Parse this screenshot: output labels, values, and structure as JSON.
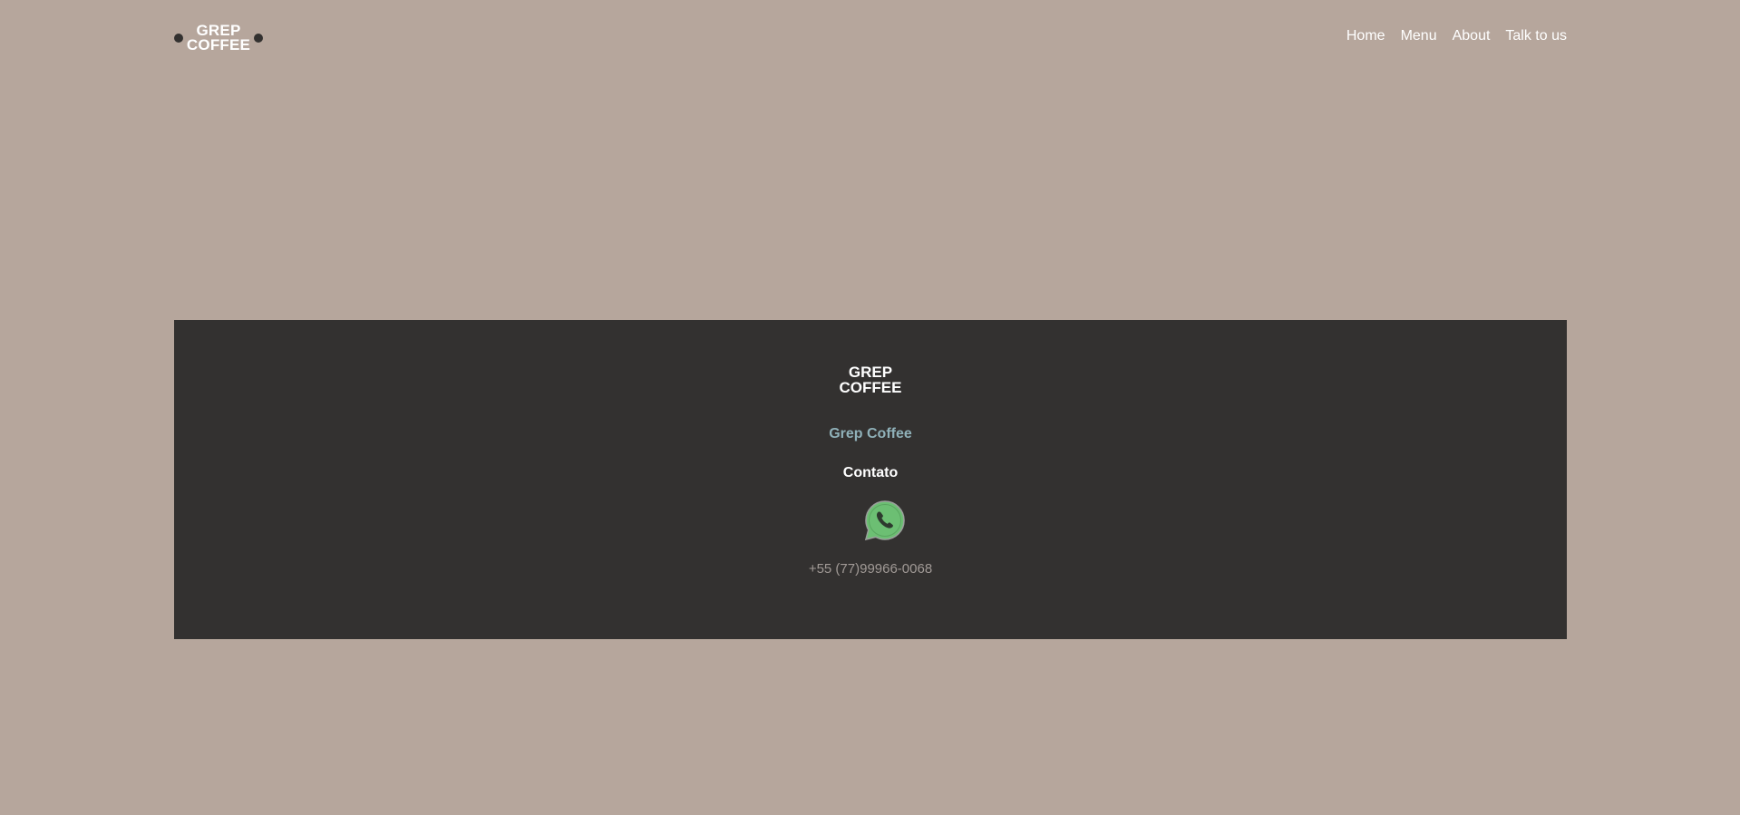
{
  "header": {
    "logo": {
      "line1": "GREP",
      "line2": "COFFEE"
    },
    "nav": [
      {
        "label": "Home"
      },
      {
        "label": "Menu"
      },
      {
        "label": "About"
      },
      {
        "label": "Talk to us"
      }
    ]
  },
  "footer": {
    "logo": {
      "line1": "GREP",
      "line2": "COFFEE"
    },
    "brand_name": "Grep Coffee",
    "contact_title": "Contato",
    "whatsapp_icon": "whatsapp-icon",
    "phone": "+55 (77)99966-0068"
  },
  "colors": {
    "page_background": "#b6a69c",
    "footer_background": "#333130",
    "brand_accent": "#8fb0b8",
    "whatsapp_green": "#6cbf73"
  }
}
